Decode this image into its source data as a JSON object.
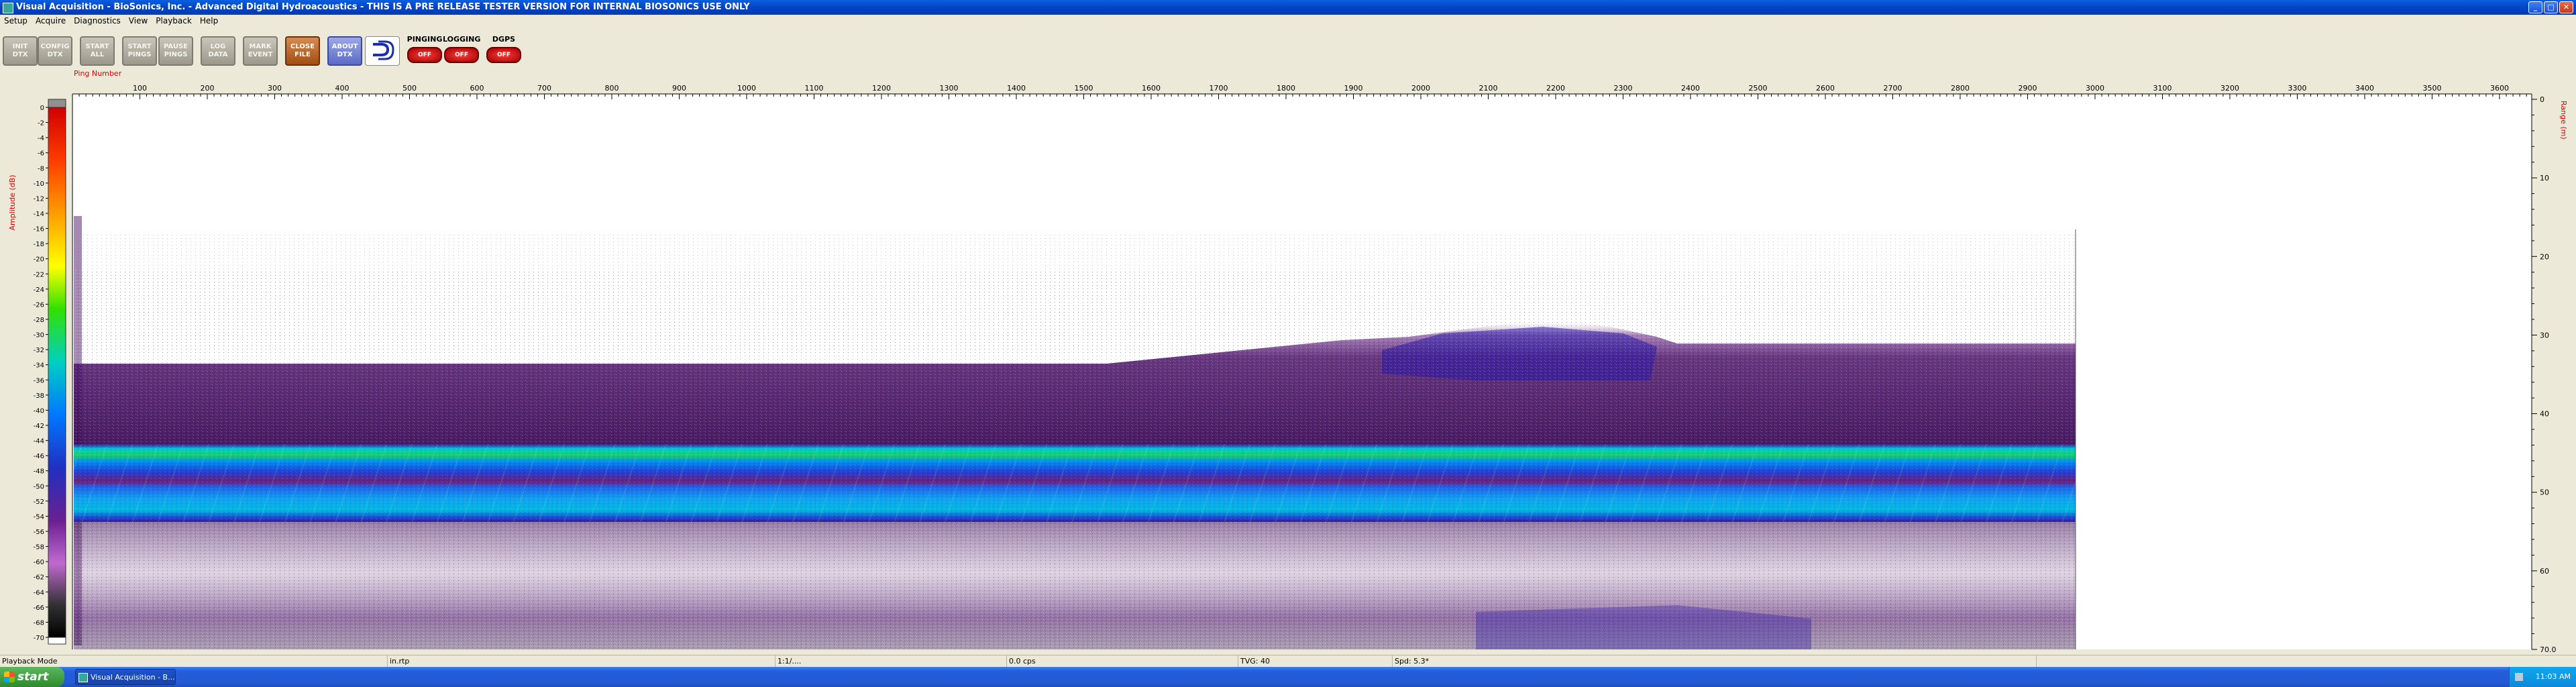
{
  "window": {
    "title": "Visual Acquisition  -  BioSonics, Inc.  -  Advanced Digital Hydroacoustics  -  THIS IS A PRE RELEASE TESTER VERSION FOR INTERNAL BIOSONICS USE ONLY"
  },
  "menu": [
    "Setup",
    "Acquire",
    "Diagnostics",
    "View",
    "Playback",
    "Help"
  ],
  "toolbar": {
    "buttons": [
      {
        "label": "INIT\nDTX"
      },
      {
        "label": "CONFIG\nDTX"
      },
      {
        "label": "START\nALL"
      },
      {
        "label": "START\nPINGS"
      },
      {
        "label": "PAUSE\nPINGS"
      },
      {
        "label": "LOG\nDATA"
      },
      {
        "label": "MARK\nEVENT"
      },
      {
        "label": "CLOSE\nFILE"
      },
      {
        "label": "ABOUT\nDTX"
      }
    ],
    "indicators": [
      {
        "label": "PINGING",
        "state": "OFF"
      },
      {
        "label": "LOGGING",
        "state": "OFF"
      },
      {
        "label": "DGPS",
        "state": "OFF"
      }
    ]
  },
  "plot": {
    "x_axis_title": "Ping Number",
    "x_ticks": [
      100,
      200,
      300,
      400,
      500,
      600,
      700,
      800,
      900,
      1000,
      1100,
      1200,
      1300,
      1400,
      1500,
      1600,
      1700,
      1800,
      1900,
      2000,
      2100,
      2200,
      2300,
      2400,
      2500,
      2600,
      2700,
      2800,
      2900,
      3000,
      3100,
      3200,
      3300,
      3400,
      3500,
      3600
    ],
    "colorbar_title": "Amplitude (dB)",
    "colorbar_ticks": [
      0,
      -2,
      -4,
      -6,
      -8,
      -10,
      -12,
      -14,
      -16,
      -18,
      -20,
      -22,
      -24,
      -26,
      -28,
      -30,
      -32,
      -34,
      -36,
      -38,
      -40,
      -42,
      -44,
      -46,
      -48,
      -50,
      -52,
      -54,
      -56,
      -58,
      -60,
      -62,
      -64,
      -66,
      -68,
      -70
    ],
    "range_axis_title": "Range (m)",
    "range_ticks": [
      "0",
      "10",
      "20",
      "30",
      "40",
      "50",
      "60",
      "70.0"
    ],
    "colors": {
      "axis_title": "#e00000",
      "water_column": "#4b1268",
      "bottom_band": "#1e60e8",
      "bottom_core": "#ffd000"
    }
  },
  "status": {
    "mode": "Playback Mode",
    "field2": "in.rtp",
    "field3": "1:1/....",
    "field4": "0.0 cps",
    "field5": "TVG: 40",
    "field6": "Spd: 5.3*"
  },
  "taskbar": {
    "start": "start",
    "task": "Visual Acquisition - B...",
    "clock": "11:03 AM"
  }
}
